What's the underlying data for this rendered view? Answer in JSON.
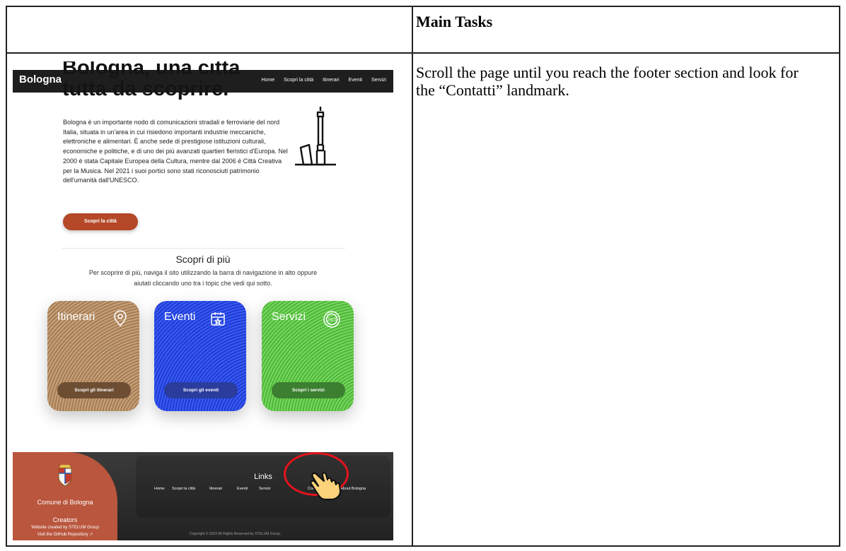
{
  "table": {
    "header_left": "",
    "header_right": "Main Tasks",
    "task_text": "Scroll the page until you reach the footer section and look for the “Contatti” landmark."
  },
  "screenshot": {
    "hero_title": "Bologna, una citta tutta da scoprire.",
    "navbar": {
      "brand": "Bologna",
      "links": [
        "Home",
        "Scopri la città",
        "Itinerari",
        "Eventi",
        "Servizi"
      ]
    },
    "intro": "Bologna è un importante nodo di comunicazioni stradali e ferroviarie del nord Italia, situata in un'area in cui risiedono importanti industrie meccaniche, elettroniche e alimentari. È anche sede di prestigiose istituzioni culturali, economiche e politiche, e di uno dei più avanzati quartieri fieristici d'Europa. Nel 2000 è stata Capitale Europea della Cultura, mentre dal 2006 è Città Creativa per la Musica. Nel 2021 i suoi portici sono stati riconosciuti patrimonio dell'umanità dall'UNESCO.",
    "discover_button": "Scopri la città",
    "more_title": "Scopri di più",
    "more_text": "Per scoprire di più, naviga il sito utilizzando la barra di navigazione in alto oppure aiutati cliccando uno tra i topic che vedi qui sotto.",
    "cards": [
      {
        "title": "Itinerari",
        "button": "Scopri gli itinerari",
        "icon": "map-pin-icon"
      },
      {
        "title": "Eventi",
        "button": "Scopri gli eventi",
        "icon": "calendar-star-icon"
      },
      {
        "title": "Servizi",
        "button": "Scopri i servizi",
        "icon": "24-7-icon"
      }
    ],
    "footer": {
      "comune": "Comune di Bologna",
      "creators": "Creators",
      "credit": "Website created by STELUM Group",
      "repo": "Visit the GitHub Repository ↗",
      "links_title": "Links",
      "links": [
        "Home",
        "Scopri la città",
        "Itinerari",
        "Eventi",
        "Servizi",
        "Contatti",
        "About Bologna"
      ],
      "copyright": "Copyright © 2022 All Rights Reserved by STELUM Group."
    }
  },
  "colors": {
    "accent_red": "#b44827",
    "highlight_red": "#e4131b",
    "footer_dark": "#2b2b2b"
  }
}
